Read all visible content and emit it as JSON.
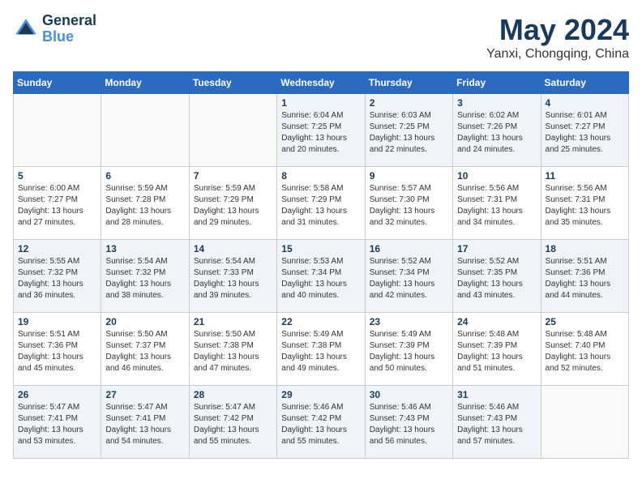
{
  "header": {
    "logo_line1": "General",
    "logo_line2": "Blue",
    "month": "May 2024",
    "location": "Yanxi, Chongqing, China"
  },
  "weekdays": [
    "Sunday",
    "Monday",
    "Tuesday",
    "Wednesday",
    "Thursday",
    "Friday",
    "Saturday"
  ],
  "weeks": [
    [
      {
        "day": "",
        "sunrise": "",
        "sunset": "",
        "daylight": ""
      },
      {
        "day": "",
        "sunrise": "",
        "sunset": "",
        "daylight": ""
      },
      {
        "day": "",
        "sunrise": "",
        "sunset": "",
        "daylight": ""
      },
      {
        "day": "1",
        "sunrise": "Sunrise: 6:04 AM",
        "sunset": "Sunset: 7:25 PM",
        "daylight": "Daylight: 13 hours and 20 minutes."
      },
      {
        "day": "2",
        "sunrise": "Sunrise: 6:03 AM",
        "sunset": "Sunset: 7:25 PM",
        "daylight": "Daylight: 13 hours and 22 minutes."
      },
      {
        "day": "3",
        "sunrise": "Sunrise: 6:02 AM",
        "sunset": "Sunset: 7:26 PM",
        "daylight": "Daylight: 13 hours and 24 minutes."
      },
      {
        "day": "4",
        "sunrise": "Sunrise: 6:01 AM",
        "sunset": "Sunset: 7:27 PM",
        "daylight": "Daylight: 13 hours and 25 minutes."
      }
    ],
    [
      {
        "day": "5",
        "sunrise": "Sunrise: 6:00 AM",
        "sunset": "Sunset: 7:27 PM",
        "daylight": "Daylight: 13 hours and 27 minutes."
      },
      {
        "day": "6",
        "sunrise": "Sunrise: 5:59 AM",
        "sunset": "Sunset: 7:28 PM",
        "daylight": "Daylight: 13 hours and 28 minutes."
      },
      {
        "day": "7",
        "sunrise": "Sunrise: 5:59 AM",
        "sunset": "Sunset: 7:29 PM",
        "daylight": "Daylight: 13 hours and 29 minutes."
      },
      {
        "day": "8",
        "sunrise": "Sunrise: 5:58 AM",
        "sunset": "Sunset: 7:29 PM",
        "daylight": "Daylight: 13 hours and 31 minutes."
      },
      {
        "day": "9",
        "sunrise": "Sunrise: 5:57 AM",
        "sunset": "Sunset: 7:30 PM",
        "daylight": "Daylight: 13 hours and 32 minutes."
      },
      {
        "day": "10",
        "sunrise": "Sunrise: 5:56 AM",
        "sunset": "Sunset: 7:31 PM",
        "daylight": "Daylight: 13 hours and 34 minutes."
      },
      {
        "day": "11",
        "sunrise": "Sunrise: 5:56 AM",
        "sunset": "Sunset: 7:31 PM",
        "daylight": "Daylight: 13 hours and 35 minutes."
      }
    ],
    [
      {
        "day": "12",
        "sunrise": "Sunrise: 5:55 AM",
        "sunset": "Sunset: 7:32 PM",
        "daylight": "Daylight: 13 hours and 36 minutes."
      },
      {
        "day": "13",
        "sunrise": "Sunrise: 5:54 AM",
        "sunset": "Sunset: 7:32 PM",
        "daylight": "Daylight: 13 hours and 38 minutes."
      },
      {
        "day": "14",
        "sunrise": "Sunrise: 5:54 AM",
        "sunset": "Sunset: 7:33 PM",
        "daylight": "Daylight: 13 hours and 39 minutes."
      },
      {
        "day": "15",
        "sunrise": "Sunrise: 5:53 AM",
        "sunset": "Sunset: 7:34 PM",
        "daylight": "Daylight: 13 hours and 40 minutes."
      },
      {
        "day": "16",
        "sunrise": "Sunrise: 5:52 AM",
        "sunset": "Sunset: 7:34 PM",
        "daylight": "Daylight: 13 hours and 42 minutes."
      },
      {
        "day": "17",
        "sunrise": "Sunrise: 5:52 AM",
        "sunset": "Sunset: 7:35 PM",
        "daylight": "Daylight: 13 hours and 43 minutes."
      },
      {
        "day": "18",
        "sunrise": "Sunrise: 5:51 AM",
        "sunset": "Sunset: 7:36 PM",
        "daylight": "Daylight: 13 hours and 44 minutes."
      }
    ],
    [
      {
        "day": "19",
        "sunrise": "Sunrise: 5:51 AM",
        "sunset": "Sunset: 7:36 PM",
        "daylight": "Daylight: 13 hours and 45 minutes."
      },
      {
        "day": "20",
        "sunrise": "Sunrise: 5:50 AM",
        "sunset": "Sunset: 7:37 PM",
        "daylight": "Daylight: 13 hours and 46 minutes."
      },
      {
        "day": "21",
        "sunrise": "Sunrise: 5:50 AM",
        "sunset": "Sunset: 7:38 PM",
        "daylight": "Daylight: 13 hours and 47 minutes."
      },
      {
        "day": "22",
        "sunrise": "Sunrise: 5:49 AM",
        "sunset": "Sunset: 7:38 PM",
        "daylight": "Daylight: 13 hours and 49 minutes."
      },
      {
        "day": "23",
        "sunrise": "Sunrise: 5:49 AM",
        "sunset": "Sunset: 7:39 PM",
        "daylight": "Daylight: 13 hours and 50 minutes."
      },
      {
        "day": "24",
        "sunrise": "Sunrise: 5:48 AM",
        "sunset": "Sunset: 7:39 PM",
        "daylight": "Daylight: 13 hours and 51 minutes."
      },
      {
        "day": "25",
        "sunrise": "Sunrise: 5:48 AM",
        "sunset": "Sunset: 7:40 PM",
        "daylight": "Daylight: 13 hours and 52 minutes."
      }
    ],
    [
      {
        "day": "26",
        "sunrise": "Sunrise: 5:47 AM",
        "sunset": "Sunset: 7:41 PM",
        "daylight": "Daylight: 13 hours and 53 minutes."
      },
      {
        "day": "27",
        "sunrise": "Sunrise: 5:47 AM",
        "sunset": "Sunset: 7:41 PM",
        "daylight": "Daylight: 13 hours and 54 minutes."
      },
      {
        "day": "28",
        "sunrise": "Sunrise: 5:47 AM",
        "sunset": "Sunset: 7:42 PM",
        "daylight": "Daylight: 13 hours and 55 minutes."
      },
      {
        "day": "29",
        "sunrise": "Sunrise: 5:46 AM",
        "sunset": "Sunset: 7:42 PM",
        "daylight": "Daylight: 13 hours and 55 minutes."
      },
      {
        "day": "30",
        "sunrise": "Sunrise: 5:46 AM",
        "sunset": "Sunset: 7:43 PM",
        "daylight": "Daylight: 13 hours and 56 minutes."
      },
      {
        "day": "31",
        "sunrise": "Sunrise: 5:46 AM",
        "sunset": "Sunset: 7:43 PM",
        "daylight": "Daylight: 13 hours and 57 minutes."
      },
      {
        "day": "",
        "sunrise": "",
        "sunset": "",
        "daylight": ""
      }
    ]
  ]
}
